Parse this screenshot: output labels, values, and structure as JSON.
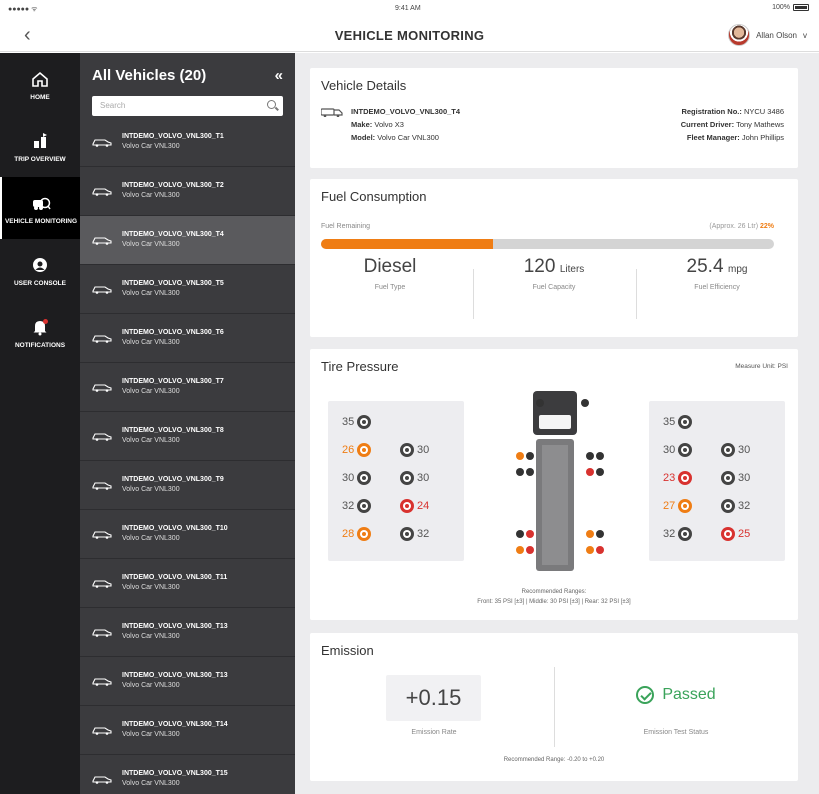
{
  "status_bar": {
    "carrier": "●●●●● ᯤ",
    "time": "9:41 AM",
    "battery": "100%"
  },
  "header": {
    "back_label": "‹",
    "title": "VEHICLE MONITORING",
    "user_name": "Allan Olson",
    "user_chevron": "v"
  },
  "nav": {
    "items": [
      {
        "label": "HOME",
        "icon": "home-icon"
      },
      {
        "label": "TRIP OVERVIEW",
        "icon": "trip-icon"
      },
      {
        "label": "VEHICLE MONITORING",
        "icon": "vehicle-monitoring-icon",
        "active": true
      },
      {
        "label": "USER CONSOLE",
        "icon": "user-console-icon"
      },
      {
        "label": "NOTIFICATIONS",
        "icon": "bell-icon"
      }
    ]
  },
  "vehicle_list": {
    "title": "All Vehicles (20)",
    "collapse_icon": "«",
    "search_placeholder": "Search",
    "items": [
      {
        "name": "INTDEMO_VOLVO_VNL300_T1",
        "model": "Volvo Car VNL300"
      },
      {
        "name": "INTDEMO_VOLVO_VNL300_T2",
        "model": "Volvo Car VNL300"
      },
      {
        "name": "INTDEMO_VOLVO_VNL300_T4",
        "model": "Volvo Car VNL300",
        "selected": true
      },
      {
        "name": "INTDEMO_VOLVO_VNL300_T5",
        "model": "Volvo Car VNL300"
      },
      {
        "name": "INTDEMO_VOLVO_VNL300_T6",
        "model": "Volvo Car VNL300"
      },
      {
        "name": "INTDEMO_VOLVO_VNL300_T7",
        "model": "Volvo Car VNL300"
      },
      {
        "name": "INTDEMO_VOLVO_VNL300_T8",
        "model": "Volvo Car VNL300"
      },
      {
        "name": "INTDEMO_VOLVO_VNL300_T9",
        "model": "Volvo Car VNL300"
      },
      {
        "name": "INTDEMO_VOLVO_VNL300_T10",
        "model": "Volvo Car VNL300"
      },
      {
        "name": "INTDEMO_VOLVO_VNL300_T11",
        "model": "Volvo Car VNL300"
      },
      {
        "name": "INTDEMO_VOLVO_VNL300_T13",
        "model": "Volvo Car VNL300"
      },
      {
        "name": "INTDEMO_VOLVO_VNL300_T13",
        "model": "Volvo Car VNL300"
      },
      {
        "name": "INTDEMO_VOLVO_VNL300_T14",
        "model": "Volvo Car VNL300"
      },
      {
        "name": "INTDEMO_VOLVO_VNL300_T15",
        "model": "Volvo Car VNL300"
      }
    ]
  },
  "vehicle_details": {
    "title": "Vehicle Details",
    "vehicle_name": "INTDEMO_VOLVO_VNL300_T4",
    "make_label": "Make:",
    "make": "Volvo X3",
    "model_label": "Model:",
    "model": "Volvo Car VNL300",
    "registration_label": "Registration No.:",
    "registration": "NYCU 3486",
    "driver_label": "Current Driver:",
    "driver": "Tony Mathews",
    "fleet_manager_label": "Fleet Manager:",
    "fleet_manager": "John Phillips"
  },
  "fuel": {
    "title": "Fuel Consumption",
    "remaining_label": "Fuel Remaining",
    "remaining_approx": "(Approx. 26 Ltr)",
    "remaining_percent_text": "22%",
    "remaining_fraction": 0.38,
    "stats": [
      {
        "value": "Diesel",
        "unit": "",
        "caption": "Fuel Type"
      },
      {
        "value": "120",
        "unit": "Liters",
        "caption": "Fuel Capacity"
      },
      {
        "value": "25.4",
        "unit": "mpg",
        "caption": "Fuel Efficiency"
      }
    ]
  },
  "tire_pressure": {
    "title": "Tire Pressure",
    "unit_label": "Measure Unit: PSI",
    "left_panel": [
      {
        "value": "35",
        "status": "normal"
      },
      {
        "value": "26",
        "status": "warning"
      },
      {
        "value": "30",
        "status": "normal"
      },
      {
        "value": "30",
        "status": "normal"
      },
      {
        "value": "30",
        "status": "normal"
      },
      {
        "value": "32",
        "status": "normal"
      },
      {
        "value": "24",
        "status": "critical"
      },
      {
        "value": "28",
        "status": "warning"
      },
      {
        "value": "32",
        "status": "normal"
      }
    ],
    "right_panel": [
      {
        "value": "35",
        "status": "normal"
      },
      {
        "value": "30",
        "status": "normal"
      },
      {
        "value": "30",
        "status": "normal"
      },
      {
        "value": "23",
        "status": "critical"
      },
      {
        "value": "30",
        "status": "normal"
      },
      {
        "value": "27",
        "status": "warning"
      },
      {
        "value": "32",
        "status": "normal"
      },
      {
        "value": "32",
        "status": "normal"
      },
      {
        "value": "25",
        "status": "critical"
      }
    ],
    "recommended_label": "Recommended Ranges:",
    "recommended_text": "Front: 35 PSI [±3] | Middle: 30 PSI [±3] | Rear: 32 PSI [±3]"
  },
  "emission": {
    "title": "Emission",
    "rate_value": "+0.15",
    "rate_caption": "Emission Rate",
    "status_value": "Passed",
    "status_caption": "Emission Test Status",
    "recommended_text": "Recommended Range: -0.20 to +0.20"
  },
  "colors": {
    "accent": "#ef7d14",
    "critical": "#d8322f",
    "ok": "#3aa35a",
    "sidebar": "#1d1d1f",
    "list": "#3b3b3e"
  }
}
